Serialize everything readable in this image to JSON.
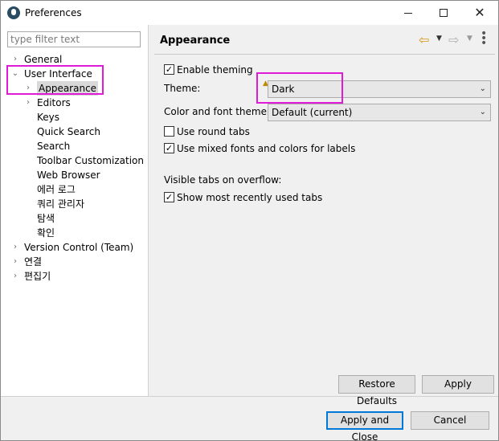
{
  "window": {
    "title": "Preferences",
    "minimize": "—",
    "maximize": "□",
    "close": "✕"
  },
  "filter": {
    "placeholder": "type filter text"
  },
  "tree": [
    {
      "label": "General",
      "level": 0,
      "arrow": "›"
    },
    {
      "label": "User Interface",
      "level": 0,
      "arrow": "⌄"
    },
    {
      "label": "Appearance",
      "level": 1,
      "arrow": "›",
      "selected": true
    },
    {
      "label": "Editors",
      "level": 1,
      "arrow": "›"
    },
    {
      "label": "Keys",
      "level": 1,
      "arrow": ""
    },
    {
      "label": "Quick Search",
      "level": 1,
      "arrow": ""
    },
    {
      "label": "Search",
      "level": 1,
      "arrow": ""
    },
    {
      "label": "Toolbar Customization",
      "level": 1,
      "arrow": ""
    },
    {
      "label": "Web Browser",
      "level": 1,
      "arrow": ""
    },
    {
      "label": "에러 로그",
      "level": 1,
      "arrow": ""
    },
    {
      "label": "쿼리 관리자",
      "level": 1,
      "arrow": ""
    },
    {
      "label": "탐색",
      "level": 1,
      "arrow": ""
    },
    {
      "label": "확인",
      "level": 1,
      "arrow": ""
    },
    {
      "label": "Version Control (Team)",
      "level": 0,
      "arrow": "›"
    },
    {
      "label": "연결",
      "level": 0,
      "arrow": "›"
    },
    {
      "label": "편집기",
      "level": 0,
      "arrow": "›"
    }
  ],
  "pane": {
    "title": "Appearance",
    "enable_theming": {
      "label": "Enable theming",
      "checked": true
    },
    "theme": {
      "label": "Theme:",
      "value": "Dark"
    },
    "color_font_theme": {
      "label": "Color and font theme:",
      "value": "Default (current)"
    },
    "round_tabs": {
      "label": "Use round tabs",
      "checked": false
    },
    "mixed_fonts": {
      "label": "Use mixed fonts and colors for labels",
      "checked": true
    },
    "overflow_heading": "Visible tabs on overflow:",
    "recent_tabs": {
      "label": "Show most recently used tabs",
      "checked": true
    }
  },
  "icons": {
    "back": "⇦",
    "forward": "⇨",
    "dropdown": "▼",
    "menu": "⋮",
    "chevron": "⌄",
    "warning": "▲",
    "check": "✓"
  },
  "buttons": {
    "restore_defaults": "Restore Defaults",
    "apply": "Apply",
    "apply_close": "Apply and Close",
    "cancel": "Cancel"
  },
  "colors": {
    "highlight": "#e01ad6",
    "default_button_border": "#0078d7",
    "back_arrow": "#d49a1a"
  }
}
